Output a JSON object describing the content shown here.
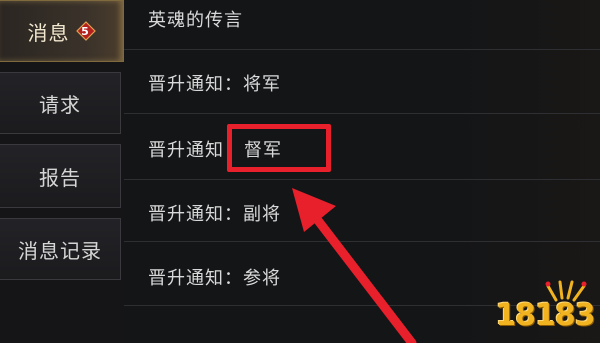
{
  "sidebar": {
    "tabs": [
      {
        "label": "消息",
        "badge": "5",
        "active": true
      },
      {
        "label": "请求",
        "active": false
      },
      {
        "label": "报告",
        "active": false
      },
      {
        "label": "消息记录",
        "active": false
      }
    ]
  },
  "messages": [
    {
      "title": "英魂的传言"
    },
    {
      "title": "晋升通知：将军"
    },
    {
      "prefix": "晋升通知",
      "rank": "督军"
    },
    {
      "title": "晋升通知：副将"
    },
    {
      "title": "晋升通知：参将"
    }
  ],
  "annotation": {
    "box_color": "#e8202b",
    "arrow_color": "#e8202b"
  },
  "watermark": {
    "text": "18183"
  },
  "colors": {
    "accent_gold": "#c9a860",
    "badge_red": "#b3201d",
    "background": "#141517"
  }
}
